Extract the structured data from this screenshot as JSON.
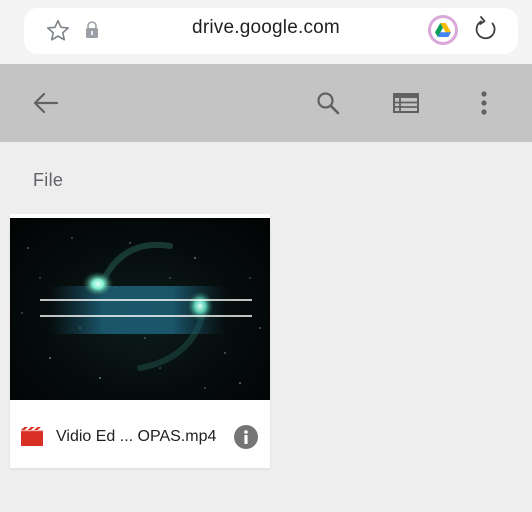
{
  "browser": {
    "url": "drive.google.com",
    "icons": [
      "star-icon",
      "lock-icon",
      "google-drive-icon",
      "reload-icon"
    ]
  },
  "toolbar": {
    "icons": [
      "back-arrow-icon",
      "search-icon",
      "list-view-icon",
      "more-vert-icon"
    ]
  },
  "section": {
    "title": "File"
  },
  "files": [
    {
      "name": "Vidio Ed ... OPAS.mp4",
      "type_icon": "video-file-icon",
      "type_color": "#d93025",
      "info_icon": "info-icon"
    }
  ],
  "colors": {
    "toolbar_bg": "#c4c4c4",
    "page_bg": "#eeeeee",
    "video_red": "#d93025",
    "thumb_glow": "#5fe0c0"
  }
}
